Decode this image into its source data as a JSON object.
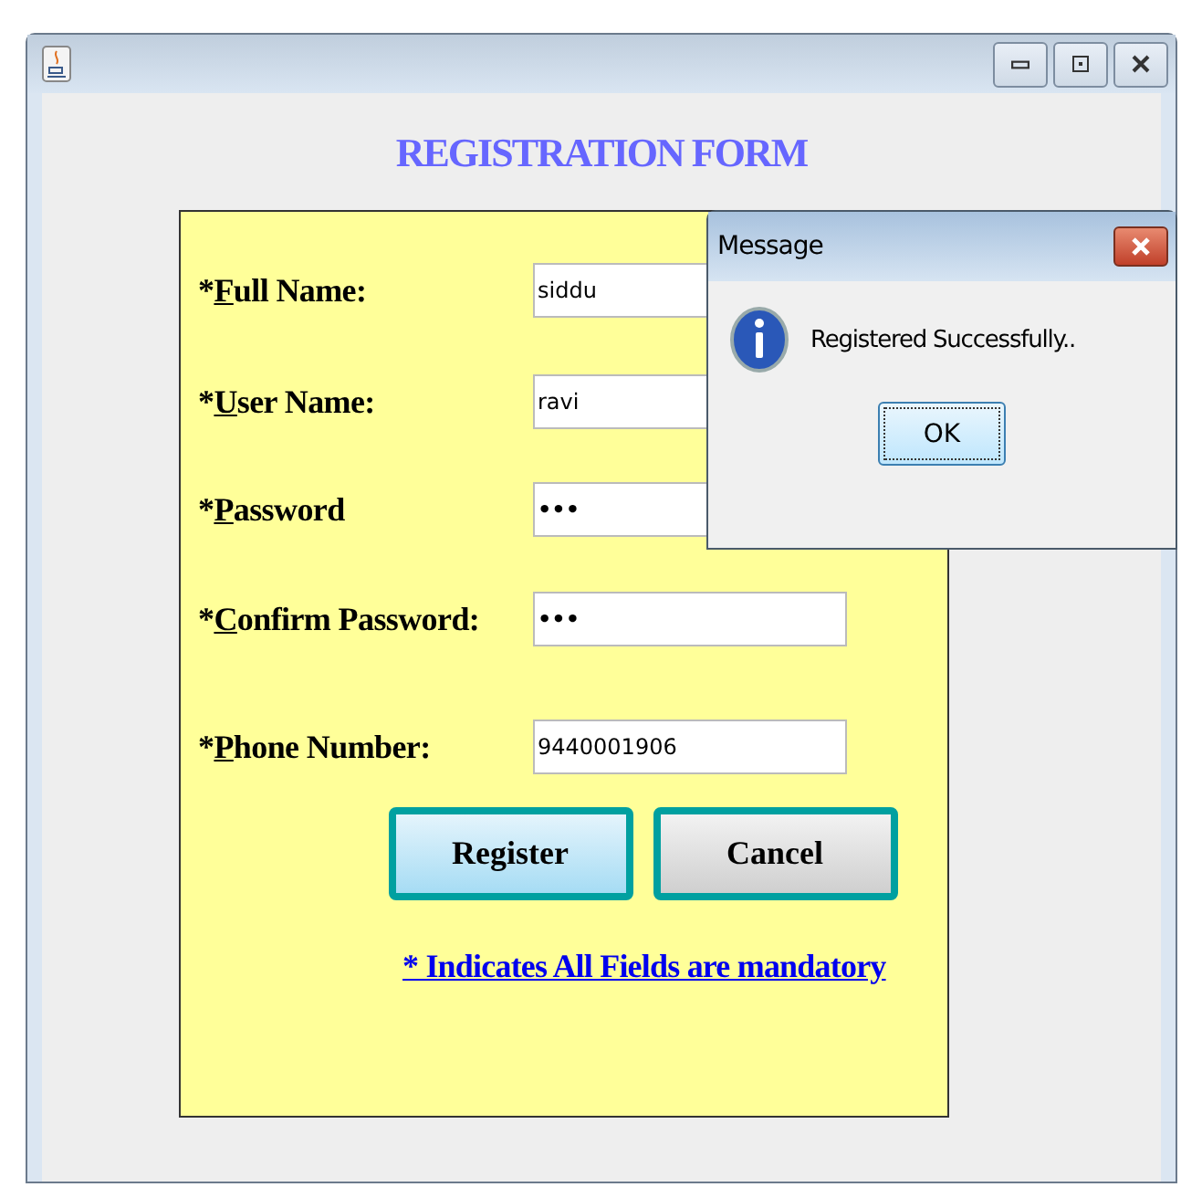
{
  "heading": "REGISTRATION FORM",
  "fields": [
    {
      "mark": "*",
      "key": "F",
      "rest": "ull Name:",
      "value": "siddu"
    },
    {
      "mark": "*",
      "key": "U",
      "rest": "ser Name:",
      "value": "ravi"
    },
    {
      "mark": "*",
      "key": "P",
      "rest": "assword",
      "value": "•••"
    },
    {
      "mark": "*",
      "key": "C",
      "rest": "onfirm Password:",
      "value": "•••"
    },
    {
      "mark": "*",
      "key": "P",
      "rest": "hone Number:",
      "value": "9440001906"
    }
  ],
  "buttons": [
    {
      "label": "Register",
      "selected": true
    },
    {
      "label": "Cancel",
      "selected": false
    }
  ],
  "note": "* Indicates All Fields are mandatory",
  "dialog": {
    "title": "Message",
    "message": "Registered Successfully..",
    "button": "OK"
  }
}
